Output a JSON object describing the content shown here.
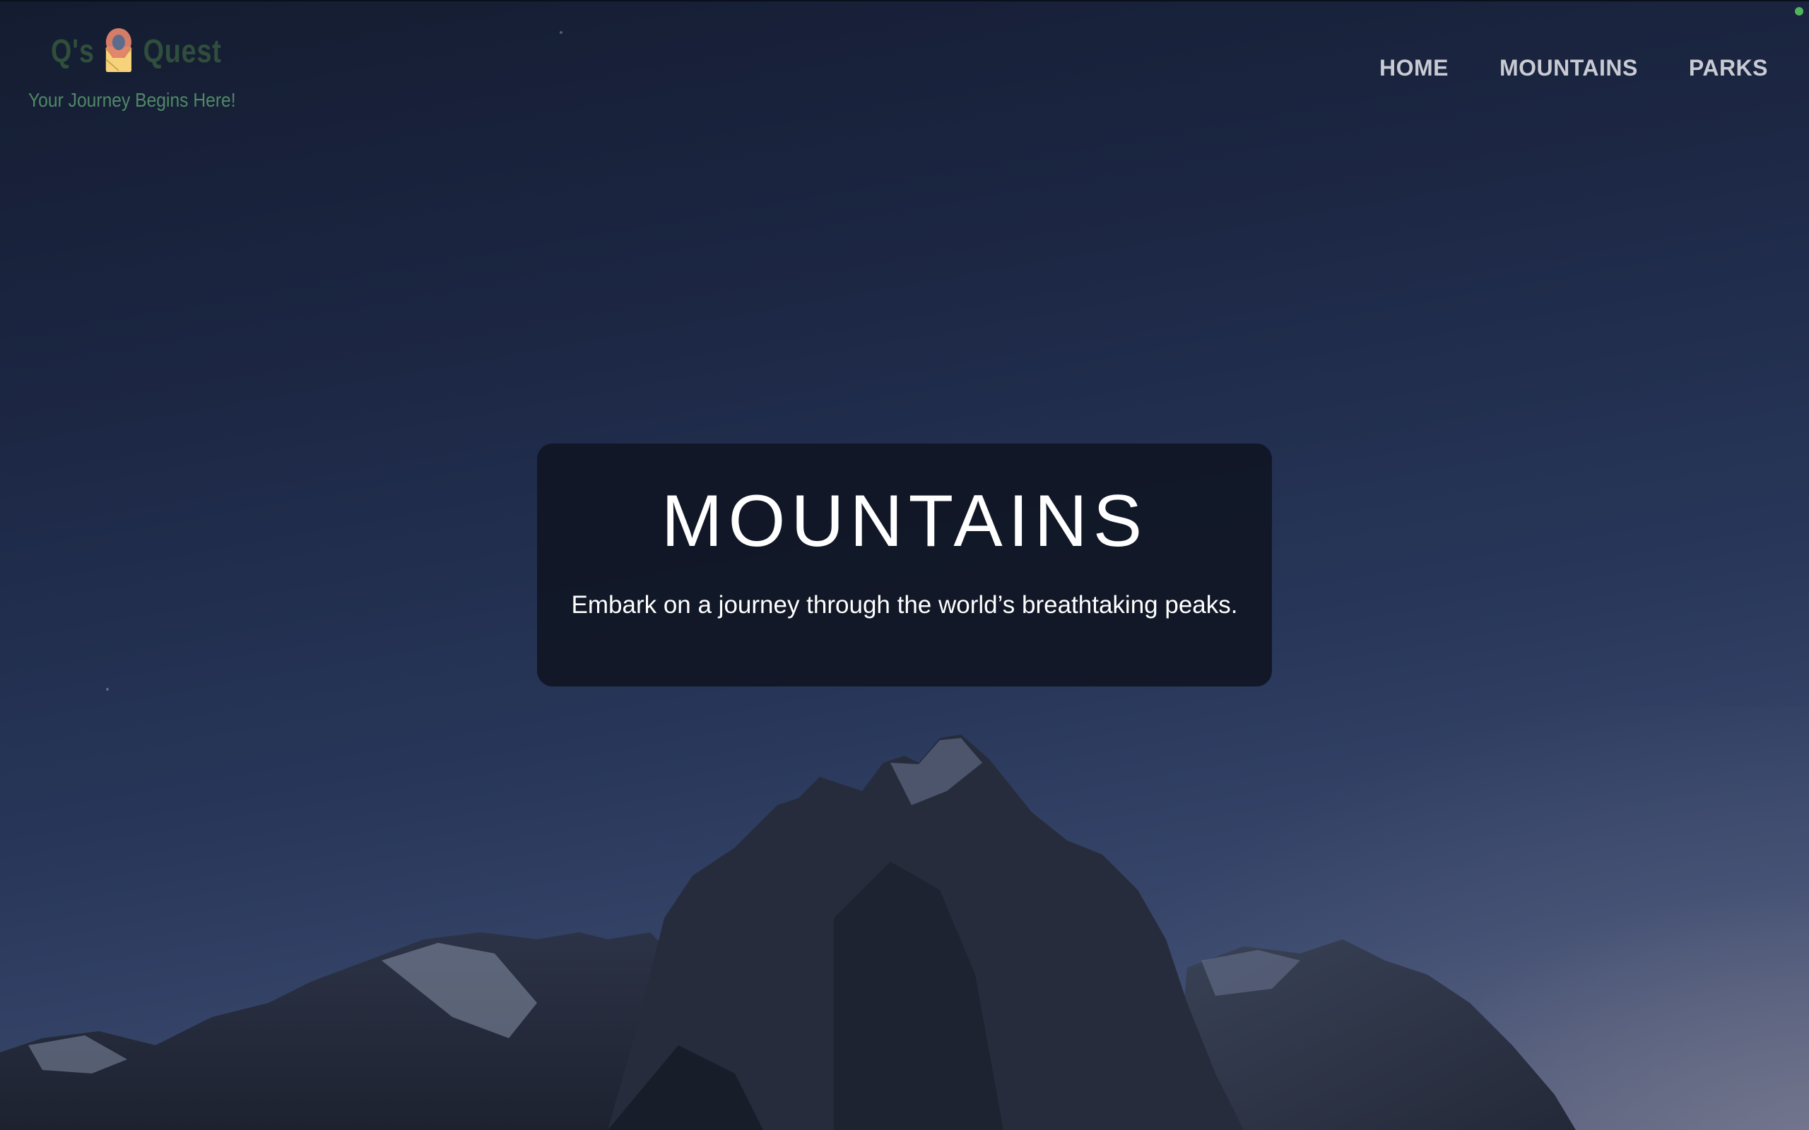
{
  "site": {
    "logo_prefix": "Q's",
    "logo_suffix": "Quest",
    "tagline": "Your Journey Begins Here!",
    "logo_icon": "map-pin-envelope-icon"
  },
  "nav": {
    "items": [
      {
        "label": "HOME"
      },
      {
        "label": "MOUNTAINS"
      },
      {
        "label": "PARKS"
      }
    ]
  },
  "hero": {
    "title": "MOUNTAINS",
    "subtitle": "Embark on a journey through the world’s breathtaking peaks."
  },
  "colors": {
    "logo_text": "#2f4f3c",
    "tagline": "#4f8a66",
    "nav_text": "#c9cbd2",
    "card_bg": "#101624",
    "status_dot": "#4fb45a"
  }
}
